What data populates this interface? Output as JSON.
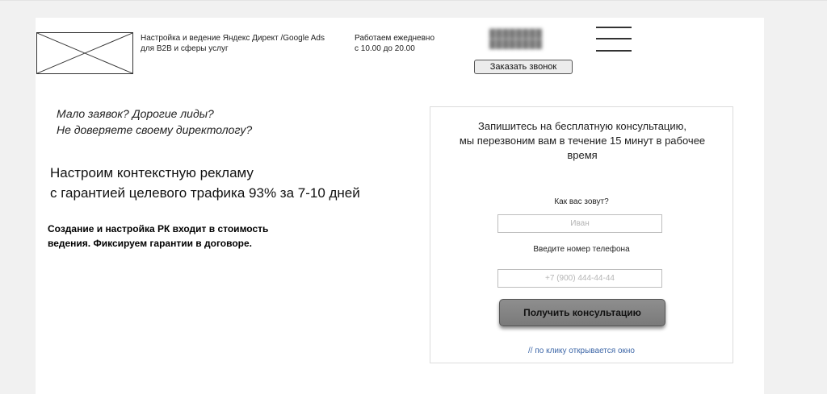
{
  "header": {
    "tagline_line1": "Настройка и ведение  Яндекс Директ /Google Ads",
    "tagline_line2": "для B2B и сферы услуг",
    "hours_line1": "Работаем ежедневно",
    "hours_line2": "с 10.00 до 20.00",
    "callback_label": "Заказать звонок"
  },
  "hero": {
    "question_line1": "Мало заявок? Дорогие лиды?",
    "question_line2": "Не доверяете своему директологу?",
    "headline_line1": "Настроим контекстную рекламу",
    "headline_line2": "с гарантией целевого трафика 93% за 7-10 дней",
    "note_line1": "Создание и настройка РК входит в стоимость",
    "note_line2": "ведения. Фиксируем гарантии в договоре."
  },
  "form": {
    "title_line1": "Запишитесь на бесплатную консультацию,",
    "title_line2": "мы перезвоним вам в течение 15 минут в рабочее",
    "title_line3": "время",
    "name_label": "Как вас зовут?",
    "name_placeholder": "Иван",
    "phone_label": "Введите номер телефона",
    "phone_placeholder": "+7 (900) 444-44-44",
    "submit_label": "Получить консультацию",
    "popup_note": "// по клику открывается окно"
  },
  "icons": {
    "logo": "logo-placeholder-icon",
    "menu": "hamburger-menu-icon"
  }
}
